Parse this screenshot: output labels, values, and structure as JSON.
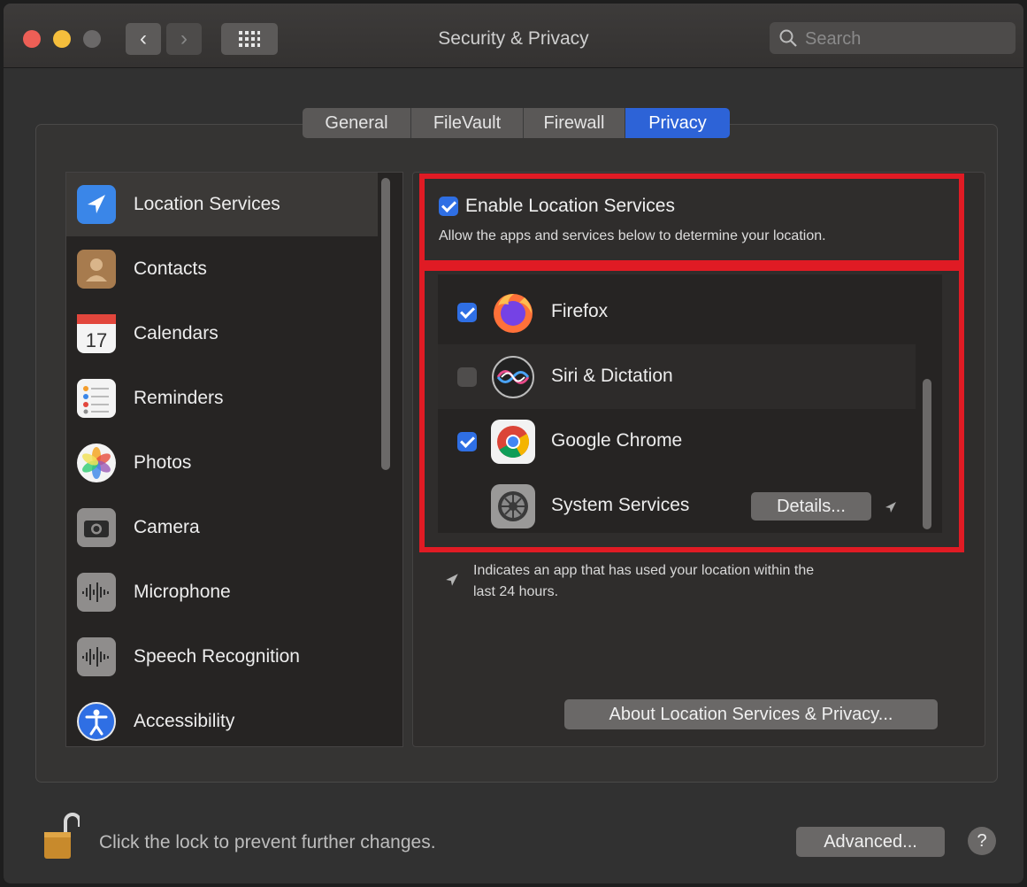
{
  "window": {
    "title": "Security & Privacy"
  },
  "toolbar": {
    "back_glyph": "‹",
    "forward_glyph": "›",
    "grid_glyph": "⋮⋮⋮",
    "search_placeholder": "Search"
  },
  "tabs": [
    {
      "label": "General"
    },
    {
      "label": "FileVault"
    },
    {
      "label": "Firewall"
    },
    {
      "label": "Privacy",
      "active": true
    }
  ],
  "sidebar": {
    "items": [
      {
        "label": "Location Services",
        "icon": "location-arrow-icon",
        "selected": true
      },
      {
        "label": "Contacts",
        "icon": "contacts-icon"
      },
      {
        "label": "Calendars",
        "icon": "calendar-icon"
      },
      {
        "label": "Reminders",
        "icon": "reminders-icon"
      },
      {
        "label": "Photos",
        "icon": "photos-icon"
      },
      {
        "label": "Camera",
        "icon": "camera-icon"
      },
      {
        "label": "Microphone",
        "icon": "microphone-icon"
      },
      {
        "label": "Speech Recognition",
        "icon": "speech-recognition-icon"
      },
      {
        "label": "Accessibility",
        "icon": "accessibility-icon"
      }
    ]
  },
  "location": {
    "enable_label": "Enable Location Services",
    "enable_checked": true,
    "description": "Allow the apps and services below to determine your location.",
    "apps": [
      {
        "name": "Firefox",
        "checked": true,
        "icon": "firefox-icon"
      },
      {
        "name": "Siri & Dictation",
        "checked": false,
        "icon": "siri-icon"
      },
      {
        "name": "Google Chrome",
        "checked": true,
        "icon": "chrome-icon"
      },
      {
        "name": "System Services",
        "icon": "system-services-gear-icon",
        "details_label": "Details..."
      }
    ],
    "legend_text_line1": "Indicates an app that has used your location within the",
    "legend_text_line2": "last 24 hours.",
    "about_button": "About Location Services & Privacy..."
  },
  "footer": {
    "lock_text": "Click the lock to prevent further changes.",
    "advanced_button": "Advanced...",
    "help_glyph": "?"
  },
  "colors": {
    "accent": "#2d63d7",
    "highlight_box": "#e01b24"
  }
}
